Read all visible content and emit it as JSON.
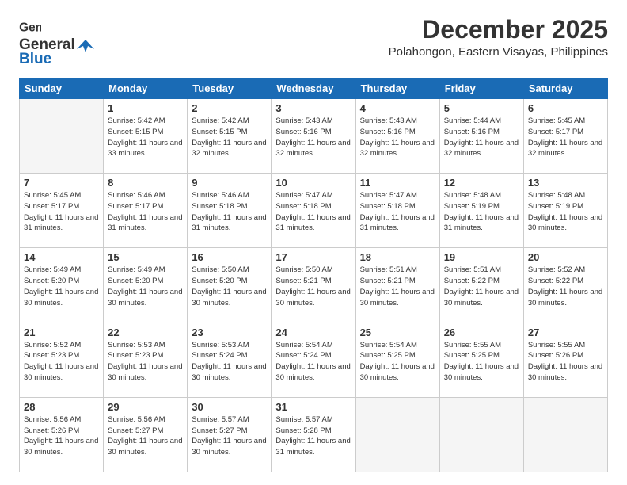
{
  "header": {
    "logo_general": "General",
    "logo_blue": "Blue",
    "month_title": "December 2025",
    "location": "Polahongon, Eastern Visayas, Philippines"
  },
  "days_of_week": [
    "Sunday",
    "Monday",
    "Tuesday",
    "Wednesday",
    "Thursday",
    "Friday",
    "Saturday"
  ],
  "weeks": [
    [
      {
        "day": "",
        "empty": true
      },
      {
        "day": "1",
        "sunrise": "5:42 AM",
        "sunset": "5:15 PM",
        "daylight": "11 hours and 33 minutes."
      },
      {
        "day": "2",
        "sunrise": "5:42 AM",
        "sunset": "5:15 PM",
        "daylight": "11 hours and 32 minutes."
      },
      {
        "day": "3",
        "sunrise": "5:43 AM",
        "sunset": "5:16 PM",
        "daylight": "11 hours and 32 minutes."
      },
      {
        "day": "4",
        "sunrise": "5:43 AM",
        "sunset": "5:16 PM",
        "daylight": "11 hours and 32 minutes."
      },
      {
        "day": "5",
        "sunrise": "5:44 AM",
        "sunset": "5:16 PM",
        "daylight": "11 hours and 32 minutes."
      },
      {
        "day": "6",
        "sunrise": "5:45 AM",
        "sunset": "5:17 PM",
        "daylight": "11 hours and 32 minutes."
      }
    ],
    [
      {
        "day": "7",
        "sunrise": "5:45 AM",
        "sunset": "5:17 PM",
        "daylight": "11 hours and 31 minutes."
      },
      {
        "day": "8",
        "sunrise": "5:46 AM",
        "sunset": "5:17 PM",
        "daylight": "11 hours and 31 minutes."
      },
      {
        "day": "9",
        "sunrise": "5:46 AM",
        "sunset": "5:18 PM",
        "daylight": "11 hours and 31 minutes."
      },
      {
        "day": "10",
        "sunrise": "5:47 AM",
        "sunset": "5:18 PM",
        "daylight": "11 hours and 31 minutes."
      },
      {
        "day": "11",
        "sunrise": "5:47 AM",
        "sunset": "5:18 PM",
        "daylight": "11 hours and 31 minutes."
      },
      {
        "day": "12",
        "sunrise": "5:48 AM",
        "sunset": "5:19 PM",
        "daylight": "11 hours and 31 minutes."
      },
      {
        "day": "13",
        "sunrise": "5:48 AM",
        "sunset": "5:19 PM",
        "daylight": "11 hours and 30 minutes."
      }
    ],
    [
      {
        "day": "14",
        "sunrise": "5:49 AM",
        "sunset": "5:20 PM",
        "daylight": "11 hours and 30 minutes."
      },
      {
        "day": "15",
        "sunrise": "5:49 AM",
        "sunset": "5:20 PM",
        "daylight": "11 hours and 30 minutes."
      },
      {
        "day": "16",
        "sunrise": "5:50 AM",
        "sunset": "5:20 PM",
        "daylight": "11 hours and 30 minutes."
      },
      {
        "day": "17",
        "sunrise": "5:50 AM",
        "sunset": "5:21 PM",
        "daylight": "11 hours and 30 minutes."
      },
      {
        "day": "18",
        "sunrise": "5:51 AM",
        "sunset": "5:21 PM",
        "daylight": "11 hours and 30 minutes."
      },
      {
        "day": "19",
        "sunrise": "5:51 AM",
        "sunset": "5:22 PM",
        "daylight": "11 hours and 30 minutes."
      },
      {
        "day": "20",
        "sunrise": "5:52 AM",
        "sunset": "5:22 PM",
        "daylight": "11 hours and 30 minutes."
      }
    ],
    [
      {
        "day": "21",
        "sunrise": "5:52 AM",
        "sunset": "5:23 PM",
        "daylight": "11 hours and 30 minutes."
      },
      {
        "day": "22",
        "sunrise": "5:53 AM",
        "sunset": "5:23 PM",
        "daylight": "11 hours and 30 minutes."
      },
      {
        "day": "23",
        "sunrise": "5:53 AM",
        "sunset": "5:24 PM",
        "daylight": "11 hours and 30 minutes."
      },
      {
        "day": "24",
        "sunrise": "5:54 AM",
        "sunset": "5:24 PM",
        "daylight": "11 hours and 30 minutes."
      },
      {
        "day": "25",
        "sunrise": "5:54 AM",
        "sunset": "5:25 PM",
        "daylight": "11 hours and 30 minutes."
      },
      {
        "day": "26",
        "sunrise": "5:55 AM",
        "sunset": "5:25 PM",
        "daylight": "11 hours and 30 minutes."
      },
      {
        "day": "27",
        "sunrise": "5:55 AM",
        "sunset": "5:26 PM",
        "daylight": "11 hours and 30 minutes."
      }
    ],
    [
      {
        "day": "28",
        "sunrise": "5:56 AM",
        "sunset": "5:26 PM",
        "daylight": "11 hours and 30 minutes."
      },
      {
        "day": "29",
        "sunrise": "5:56 AM",
        "sunset": "5:27 PM",
        "daylight": "11 hours and 30 minutes."
      },
      {
        "day": "30",
        "sunrise": "5:57 AM",
        "sunset": "5:27 PM",
        "daylight": "11 hours and 30 minutes."
      },
      {
        "day": "31",
        "sunrise": "5:57 AM",
        "sunset": "5:28 PM",
        "daylight": "11 hours and 31 minutes."
      },
      {
        "day": "",
        "empty": true
      },
      {
        "day": "",
        "empty": true
      },
      {
        "day": "",
        "empty": true
      }
    ]
  ]
}
